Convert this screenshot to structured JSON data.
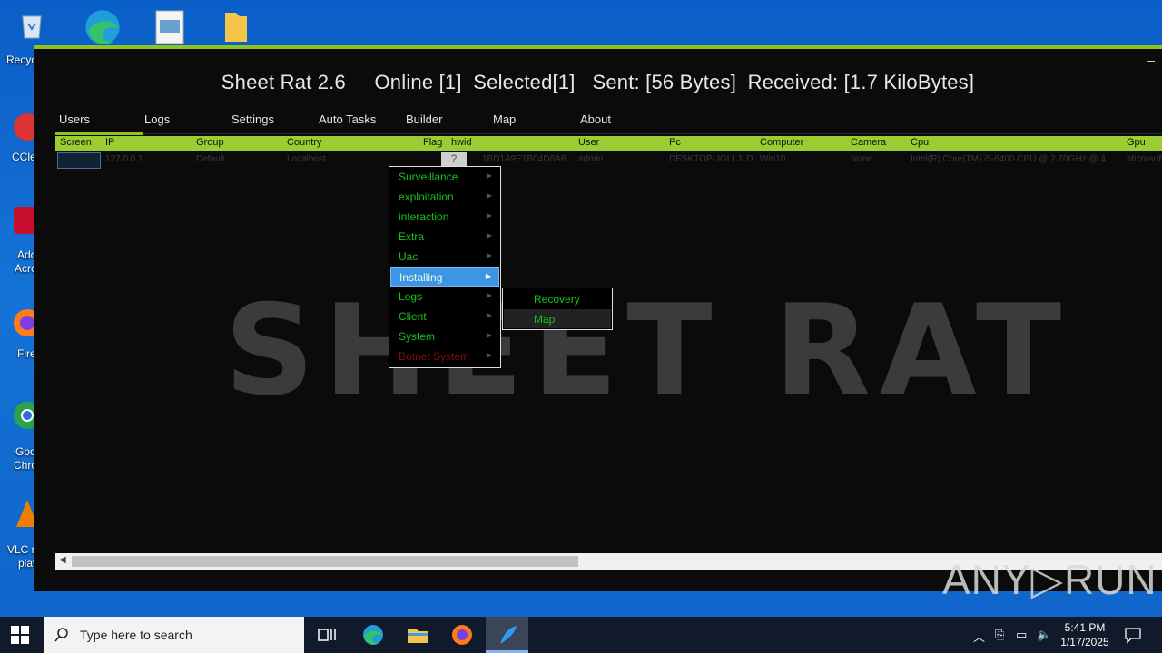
{
  "desktop": {
    "icons": [
      {
        "label": "Recyc",
        "icon": "recycle-bin-icon"
      },
      {
        "label": "CCle",
        "icon": "ccleaner-icon"
      },
      {
        "label": "Ado",
        "label2": "Acro",
        "icon": "adobe-acrobat-icon"
      },
      {
        "label": "Fire",
        "icon": "firefox-icon"
      },
      {
        "label": "Goo",
        "label2": "Chro",
        "icon": "chrome-icon"
      },
      {
        "label": "VLC r",
        "label2": "play",
        "icon": "vlc-icon"
      }
    ]
  },
  "window": {
    "title": "Sheet Rat 2.6     Online [1]  Selected[1]   Sent: [56 Bytes]  Received: [1.7 KiloBytes]",
    "minimize": "–",
    "accent": "#9acd32"
  },
  "nav": {
    "items": [
      "Users",
      "Logs",
      "Settings",
      "Auto Tasks",
      "Builder",
      "Map",
      "About"
    ],
    "active": "Users"
  },
  "table": {
    "columns": [
      "Screen",
      "IP",
      "Group",
      "Country",
      "Flag",
      "hwid",
      "User",
      "Pc",
      "Computer",
      "Camera",
      "Cpu",
      "Gpu"
    ],
    "row": {
      "ip": "127.0.0.1",
      "group": "Default",
      "country": "Localhost",
      "flag": "?",
      "hwid": "1BD1A9E1B04D6A6",
      "user": "admin",
      "pc": "DESKTOP-JGLLJLD",
      "computer": "Win10",
      "camera": "None",
      "cpu": "Intel(R) Core(TM) i5-6400 CPU @ 2.70GHz @ 4",
      "gpu": "Microsoft"
    }
  },
  "watermark": "SHEET RAT",
  "context_menu": {
    "items": [
      {
        "label": "Surveillance",
        "color": "green"
      },
      {
        "label": "exploitation",
        "color": "green"
      },
      {
        "label": "interaction",
        "color": "green"
      },
      {
        "label": "Extra",
        "color": "green"
      },
      {
        "label": "Uac",
        "color": "green"
      },
      {
        "label": "Installing",
        "color": "selected"
      },
      {
        "label": "Logs",
        "color": "green"
      },
      {
        "label": "Client",
        "color": "green"
      },
      {
        "label": "System",
        "color": "green"
      },
      {
        "label": "Botnet System",
        "color": "red"
      }
    ],
    "submenu": [
      "Recovery",
      "Map"
    ]
  },
  "taskbar": {
    "search_placeholder": "Type here to search",
    "time": "5:41 PM",
    "date": "1/17/2025"
  },
  "overlay_brand": "ANY▷RUN"
}
